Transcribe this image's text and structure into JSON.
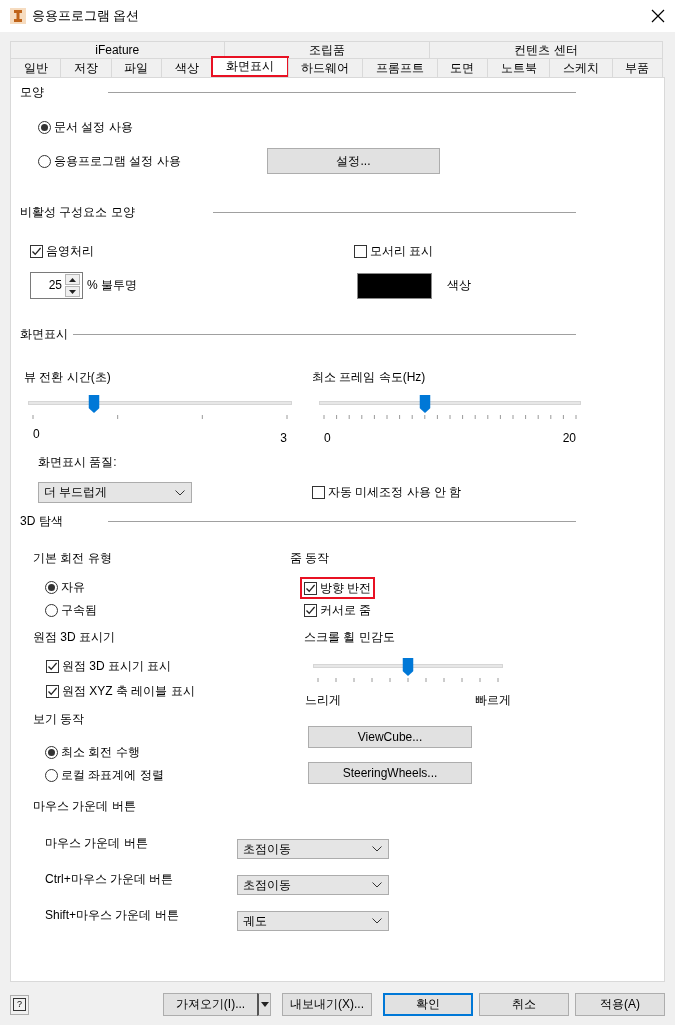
{
  "window": {
    "title": "응용프로그램 옵션"
  },
  "tab_rows": [
    [
      {
        "label": "iFeature",
        "selected": false,
        "highlighted": false
      },
      {
        "label": "조립품",
        "selected": false,
        "highlighted": false
      },
      {
        "label": "컨텐츠 센터",
        "selected": false,
        "highlighted": false
      }
    ],
    [
      {
        "label": "일반",
        "selected": false,
        "highlighted": false
      },
      {
        "label": "저장",
        "selected": false,
        "highlighted": false
      },
      {
        "label": "파일",
        "selected": false,
        "highlighted": false
      },
      {
        "label": "색상",
        "selected": false,
        "highlighted": false
      },
      {
        "label": "화면표시",
        "selected": true,
        "highlighted": true
      },
      {
        "label": "하드웨어",
        "selected": false,
        "highlighted": false
      },
      {
        "label": "프롬프트",
        "selected": false,
        "highlighted": false
      },
      {
        "label": "도면",
        "selected": false,
        "highlighted": false
      },
      {
        "label": "노트북",
        "selected": false,
        "highlighted": false
      },
      {
        "label": "스케치",
        "selected": false,
        "highlighted": false
      },
      {
        "label": "부품",
        "selected": false,
        "highlighted": false
      }
    ]
  ],
  "appearance": {
    "title": "모양",
    "options": [
      {
        "label": "문서 설정 사용",
        "selected": true
      },
      {
        "label": "응용프로그램 설정 사용",
        "selected": false
      }
    ],
    "settings_button": "설정..."
  },
  "inactive_components": {
    "title": "비활성 구성요소 모양",
    "shading": {
      "label": "음영처리",
      "checked": true
    },
    "opacity": {
      "value": "25",
      "label": "% 불투명"
    },
    "edges": {
      "label": "모서리 표시",
      "checked": false
    },
    "color": {
      "color": "#000000",
      "label": "색상"
    }
  },
  "display": {
    "title": "화면표시",
    "sliders": [
      {
        "kind": "seconds",
        "label": "뷰 전환 시간(초)",
        "level": 0.24,
        "min": "0",
        "max": "3"
      },
      {
        "kind": "hertz",
        "label": "최소 프레임 속도(Hz)",
        "level": 0.4,
        "min": "0",
        "max": "20"
      }
    ],
    "quality": {
      "label": "화면표시 품질:",
      "value": "더 부드럽게"
    },
    "auto_tune": {
      "label": "자동 미세조정 사용 안 함",
      "checked": false
    }
  },
  "navigation_3d": {
    "title": "3D 탐색",
    "rotation": {
      "title": "기본 회전 유형",
      "options": [
        {
          "label": "자유",
          "selected": true
        },
        {
          "label": "구속됨",
          "selected": false
        }
      ]
    },
    "origin_indicator": {
      "title": "원점 3D 표시기",
      "options": [
        {
          "label": "원점 3D 표시기 표시",
          "checked": true
        },
        {
          "label": "원점 XYZ 축 레이블 표시",
          "checked": true
        }
      ]
    },
    "view_behavior": {
      "title": "보기 동작",
      "options": [
        {
          "label": "최소 회전 수행",
          "selected": true
        },
        {
          "label": "로컬 좌표계에 정렬",
          "selected": false
        }
      ]
    },
    "zoom": {
      "title": "줌 동작",
      "options": [
        {
          "label": "방향 반전",
          "checked": true,
          "highlighted": true
        },
        {
          "label": "커서로 줌",
          "checked": true,
          "highlighted": false
        }
      ]
    },
    "wheel_sensitivity": {
      "kind": "sensitivity",
      "label": "스크롤 휠 민감도",
      "level": 0.5,
      "min": "느리게",
      "max": "빠르게"
    },
    "buttons": [
      "ViewCube...",
      "SteeringWheels..."
    ],
    "middle_button": {
      "title": "마우스 가운데 버튼",
      "rows": [
        {
          "label": "마우스 가운데 버튼",
          "value": "초점이동"
        },
        {
          "label": "Ctrl+마우스 가운데 버튼",
          "value": "초점이동"
        },
        {
          "label": "Shift+마우스 가운데 버튼",
          "value": "궤도"
        }
      ]
    }
  },
  "footer": {
    "help_button": "?",
    "import_button": "가져오기(I)...",
    "buttons": [
      {
        "label": "내보내기(X)...",
        "default": false
      },
      {
        "label": "확인",
        "default": true
      },
      {
        "label": "취소",
        "default": false
      },
      {
        "label": "적용(A)",
        "default": false
      }
    ]
  }
}
